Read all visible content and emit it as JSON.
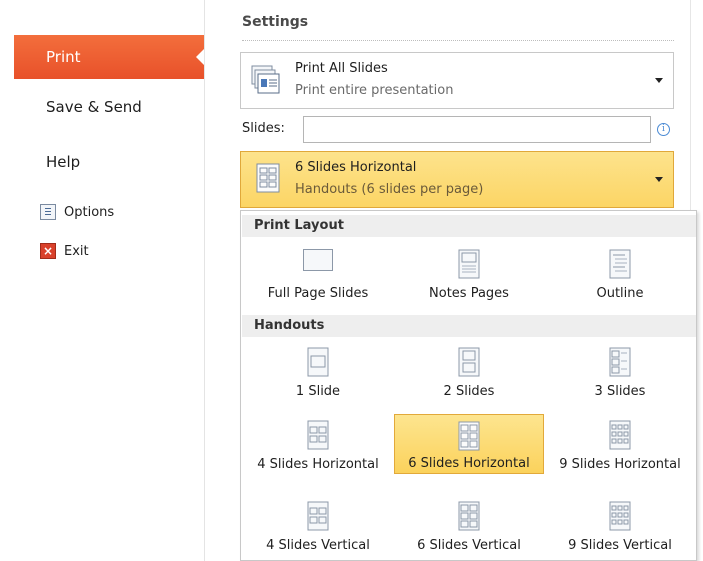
{
  "nav": {
    "print": "Print",
    "save_send": "Save & Send",
    "help": "Help",
    "options": "Options",
    "exit": "Exit"
  },
  "settings": {
    "title": "Settings",
    "print_range": {
      "title": "Print All Slides",
      "subtitle": "Print entire presentation"
    },
    "slides_label": "Slides:",
    "slides_value": "",
    "info_icon": "i",
    "layout_dropdown": {
      "title": "6 Slides Horizontal",
      "subtitle": "Handouts (6 slides per page)"
    }
  },
  "layout_panel": {
    "print_layout_heading": "Print Layout",
    "print_layout_items": [
      "Full Page Slides",
      "Notes Pages",
      "Outline"
    ],
    "handouts_heading": "Handouts",
    "handouts_items": [
      "1 Slide",
      "2 Slides",
      "3 Slides",
      "4 Slides Horizontal",
      "6 Slides Horizontal",
      "9 Slides Horizontal",
      "4 Slides Vertical",
      "6 Slides Vertical",
      "9 Slides Vertical"
    ],
    "selected": "6 Slides Horizontal"
  },
  "colors": {
    "accent": "#e8512a",
    "highlight": "#fcd565"
  }
}
